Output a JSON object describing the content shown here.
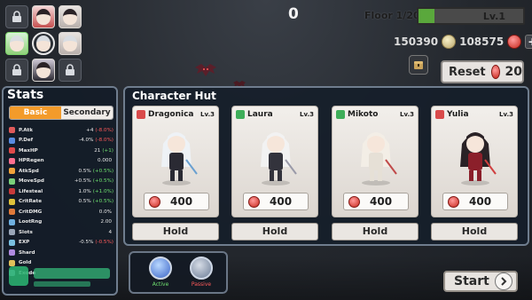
{
  "top": {
    "score": "0",
    "floor": "Floor 1/20",
    "level": "Lv.1",
    "level_progress": 0.15
  },
  "currency": {
    "gold": "150390",
    "gems": "108575",
    "plus": "+"
  },
  "reset": {
    "label": "Reset",
    "cost": "20"
  },
  "stats": {
    "title": "Stats",
    "tabs": [
      "Basic",
      "Secondary"
    ],
    "rows": [
      {
        "name": "P.Atk",
        "value": "+4",
        "bonus": "(-8.0%)",
        "bonus_color": "red",
        "icon_color": "#e05a5a"
      },
      {
        "name": "P.Def",
        "value": "-4.0%",
        "bonus": "(-8.0%)",
        "bonus_color": "red",
        "icon_color": "#5a8be0"
      },
      {
        "name": "MaxHP",
        "value": "21",
        "bonus": "(+1)",
        "bonus_color": "green",
        "icon_color": "#e04a4a"
      },
      {
        "name": "HPRegen",
        "value": "0.000",
        "bonus": "",
        "bonus_color": "",
        "icon_color": "#ff6f8f"
      },
      {
        "name": "AtkSpd",
        "value": "0.5%",
        "bonus": "(+0.5%)",
        "bonus_color": "green",
        "icon_color": "#f0a23a"
      },
      {
        "name": "MoveSpd",
        "value": "+0.5%",
        "bonus": "(+0.5%)",
        "bonus_color": "green",
        "icon_color": "#7ad07a"
      },
      {
        "name": "Lifesteal",
        "value": "1.0%",
        "bonus": "(+1.0%)",
        "bonus_color": "green",
        "icon_color": "#c83a3a"
      },
      {
        "name": "CritRate",
        "value": "0.5%",
        "bonus": "(+0.5%)",
        "bonus_color": "green",
        "icon_color": "#e0c23a"
      },
      {
        "name": "CritDMG",
        "value": "0.0%",
        "bonus": "",
        "bonus_color": "",
        "icon_color": "#e07a3a"
      },
      {
        "name": "LootRng",
        "value": "2.00",
        "bonus": "",
        "bonus_color": "",
        "icon_color": "#6fb0e0"
      },
      {
        "name": "Slots",
        "value": "4",
        "bonus": "",
        "bonus_color": "",
        "icon_color": "#9aa6b8"
      },
      {
        "name": "EXP",
        "value": "-0.5%",
        "bonus": "(-0.5%)",
        "bonus_color": "red",
        "icon_color": "#7ac0e0"
      },
      {
        "name": "Shard",
        "value": "",
        "bonus": "",
        "bonus_color": "",
        "icon_color": "#b08ae0"
      },
      {
        "name": "Gold",
        "value": "",
        "bonus": "",
        "bonus_color": "",
        "icon_color": "#e0c05a"
      },
      {
        "name": "Exode",
        "value": "",
        "bonus": "",
        "bonus_color": "",
        "icon_color": "#8ab0c8"
      }
    ]
  },
  "hut": {
    "title": "Character Hut",
    "cards": [
      {
        "name": "Dragonica",
        "level": "Lv.3",
        "price": "400",
        "hold": "Hold",
        "elem_color": "#d94b4b"
      },
      {
        "name": "Laura",
        "level": "Lv.3",
        "price": "400",
        "hold": "Hold",
        "elem_color": "#3fae5a"
      },
      {
        "name": "Mikoto",
        "level": "Lv.3",
        "price": "400",
        "hold": "Hold",
        "elem_color": "#3fae5a"
      },
      {
        "name": "Yulia",
        "level": "Lv.3",
        "price": "400",
        "hold": "Hold",
        "elem_color": "#d94b4b"
      }
    ]
  },
  "skills": {
    "active_label": "Active",
    "passive_label": "Passive"
  },
  "start": {
    "label": "Start"
  }
}
